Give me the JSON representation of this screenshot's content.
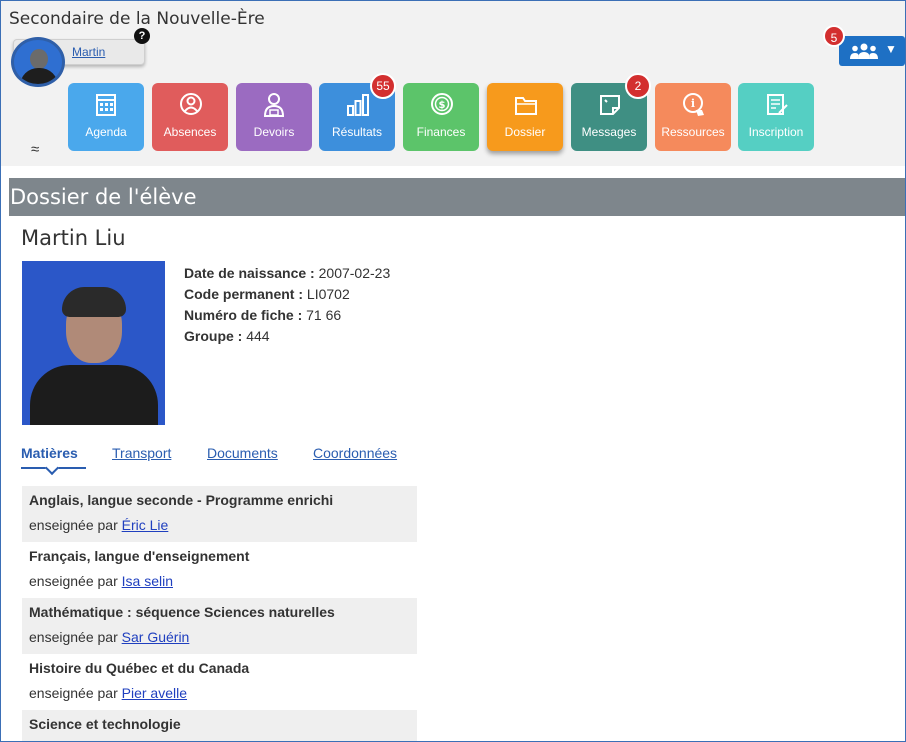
{
  "header": {
    "school_name": "Secondaire de la Nouvelle-Ère",
    "user_name": "Martin",
    "help_badge": "?",
    "group_badge": "5"
  },
  "apps": [
    {
      "label": "Agenda",
      "icon": "calendar-icon",
      "color": "#4aa8ec",
      "badge": null
    },
    {
      "label": "Absences",
      "icon": "person-circle-icon",
      "color": "#e05c5c",
      "badge": null
    },
    {
      "label": "Devoirs",
      "icon": "student-icon",
      "color": "#9b6bc1",
      "badge": null
    },
    {
      "label": "Résultats",
      "icon": "bar-chart-icon",
      "color": "#3d8fdc",
      "badge": "55"
    },
    {
      "label": "Finances",
      "icon": "dollar-icon",
      "color": "#5cc46a",
      "badge": null
    },
    {
      "label": "Dossier",
      "icon": "folder-icon",
      "color": "#f79a1c",
      "badge": null
    },
    {
      "label": "Messages",
      "icon": "note-icon",
      "color": "#3f8f83",
      "badge": "2"
    },
    {
      "label": "Ressources",
      "icon": "info-hand-icon",
      "color": "#f58a5c",
      "badge": null
    },
    {
      "label": "Inscription",
      "icon": "form-icon",
      "color": "#55cfc3",
      "badge": null
    }
  ],
  "section_title": "Dossier de l'élève",
  "student": {
    "name": "Martin Liu",
    "fields": [
      {
        "label": "Date de naissance :",
        "value": "2007-02-23"
      },
      {
        "label": "Code permanent :",
        "value": "LI0702"
      },
      {
        "label": "Numéro de fiche :",
        "value": "71 66"
      },
      {
        "label": "Groupe :",
        "value": "444"
      }
    ]
  },
  "tabs": [
    {
      "label": "Matières",
      "active": true
    },
    {
      "label": "Transport",
      "active": false
    },
    {
      "label": "Documents",
      "active": false
    },
    {
      "label": "Coordonnées",
      "active": false
    }
  ],
  "subjects": [
    {
      "title": "Anglais, langue seconde - Programme enrichi",
      "prefix": "enseignée par",
      "teacher": "Éric Lie"
    },
    {
      "title": "Français, langue d'enseignement",
      "prefix": "enseignée par",
      "teacher": "Isa selin"
    },
    {
      "title": "Mathématique : séquence Sciences naturelles",
      "prefix": "enseignée par",
      "teacher": "Sar Guérin"
    },
    {
      "title": "Histoire du Québec et du Canada",
      "prefix": "enseignée par",
      "teacher": "Pier avelle"
    },
    {
      "title": "Science et technologie",
      "prefix": "",
      "teacher": ""
    }
  ]
}
